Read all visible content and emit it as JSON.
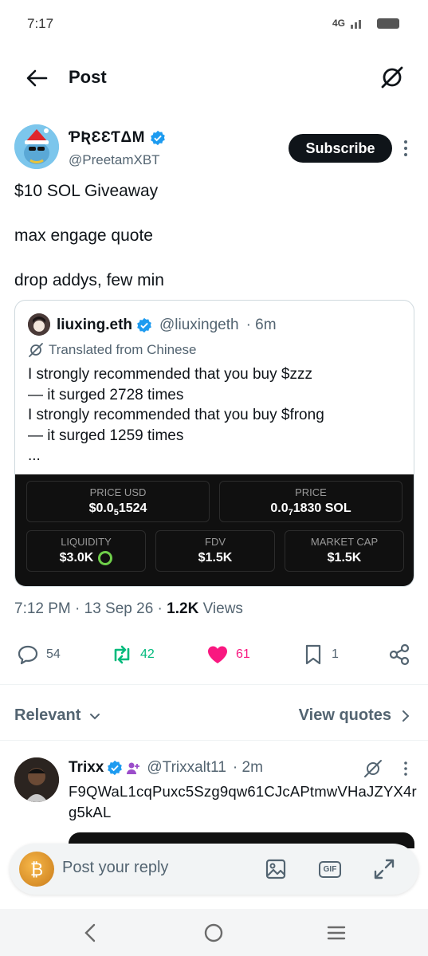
{
  "status_bar": {
    "time": "7:17",
    "network": "4G"
  },
  "header": {
    "title": "Post"
  },
  "post": {
    "author_name": "ƤƦƐƐƬΔM",
    "author_handle": "@PreetamXBT",
    "subscribe_label": "Subscribe",
    "text_lines": [
      "$10 SOL Giveaway",
      "max engage quote",
      "drop addys, few min"
    ],
    "timestamp": "7:12 PM · 13 Sep 26 · ",
    "views_count": "1.2K",
    "views_label": " Views"
  },
  "quote": {
    "name": "liuxing.eth",
    "handle": "@liuxingeth",
    "time": "· 6m",
    "translated_label": "Translated from Chinese",
    "text_lines": [
      "I strongly recommended that you buy $zzz",
      "— it surged 2728 times",
      "I strongly recommended that you buy $frong",
      "— it surged 1259 times",
      "..."
    ],
    "media": {
      "price_usd_label": "PRICE USD",
      "price_usd_prefix": "$0.0",
      "price_usd_sub": "5",
      "price_usd_suffix": "1524",
      "price_label": "PRICE",
      "price_prefix": "0.0",
      "price_sub": "7",
      "price_suffix": "1830 SOL",
      "liquidity_label": "LIQUIDITY",
      "liquidity_value": "$3.0K",
      "fdv_label": "FDV",
      "fdv_value": "$1.5K",
      "mcap_label": "MARKET CAP",
      "mcap_value": "$1.5K"
    }
  },
  "actions": {
    "replies": "54",
    "reposts": "42",
    "likes": "61",
    "bookmarks": "1",
    "colors": {
      "repost": "#00ba7c",
      "like": "#f91880",
      "muted": "#536471"
    }
  },
  "sort": {
    "relevant_label": "Relevant",
    "view_quotes_label": "View quotes"
  },
  "reply": {
    "name": "Trixx",
    "handle": "@Trixxalt11",
    "time": "· 2m",
    "text": "F9QWaL1cqPuxc5Szg9qw61CJcAPtmwVHaJZYX4rg5kAL"
  },
  "reply_bar": {
    "placeholder": "Post your reply",
    "gif_label": "GIF"
  }
}
